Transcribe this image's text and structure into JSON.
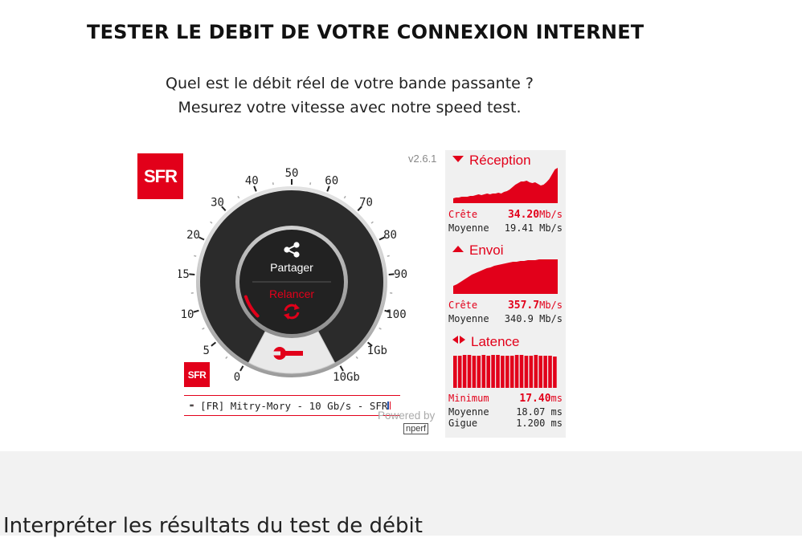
{
  "page": {
    "title": "TESTER LE DEBIT DE VOTRE CONNEXION INTERNET",
    "intro_line1": "Quel est le débit réel de votre bande passante ?",
    "intro_line2": "Mesurez votre vitesse avec notre speed test.",
    "section_heading": "Interpréter les résultats du test de débit"
  },
  "widget": {
    "logo_text": "SFR",
    "version": "v2.6.1",
    "gauge": {
      "scale_labels": [
        "0",
        "5",
        "10",
        "15",
        "20",
        "30",
        "40",
        "50",
        "60",
        "70",
        "80",
        "90",
        "100",
        "1Gb",
        "10Gb"
      ],
      "share_label": "Partager",
      "restart_label": "Relancer",
      "progress_fraction": 0.1
    },
    "server_label": "[FR] Mitry-Mory - 10 Gb/s - SFR",
    "powered_by": "Powered by",
    "brand": "nperf"
  },
  "results": {
    "download": {
      "title": "Réception",
      "peak_label": "Crête",
      "peak_value": "34.20",
      "peak_unit": "Mb/s",
      "avg_label": "Moyenne",
      "avg_value": "19.41 Mb/s"
    },
    "upload": {
      "title": "Envoi",
      "peak_label": "Crête",
      "peak_value": "357.7",
      "peak_unit": "Mb/s",
      "avg_label": "Moyenne",
      "avg_value": "340.9 Mb/s"
    },
    "latency": {
      "title": "Latence",
      "min_label": "Minimum",
      "min_value": "17.40",
      "min_unit": "ms",
      "avg_label": "Moyenne",
      "avg_value": "18.07 ms",
      "jitter_label": "Gigue",
      "jitter_value": "1.200 ms"
    }
  },
  "colors": {
    "brand_red": "#e2001a",
    "gauge_dark": "#2b2b2b",
    "panel_bg": "#f0f0f0"
  },
  "icons": {
    "share": "share-icon",
    "restart": "refresh-icon",
    "settings": "wrench-icon",
    "download": "triangle-down-icon",
    "upload": "triangle-up-icon",
    "latency": "arrows-left-right-icon",
    "server": "server-icon",
    "flag": "flag-fr-icon"
  }
}
